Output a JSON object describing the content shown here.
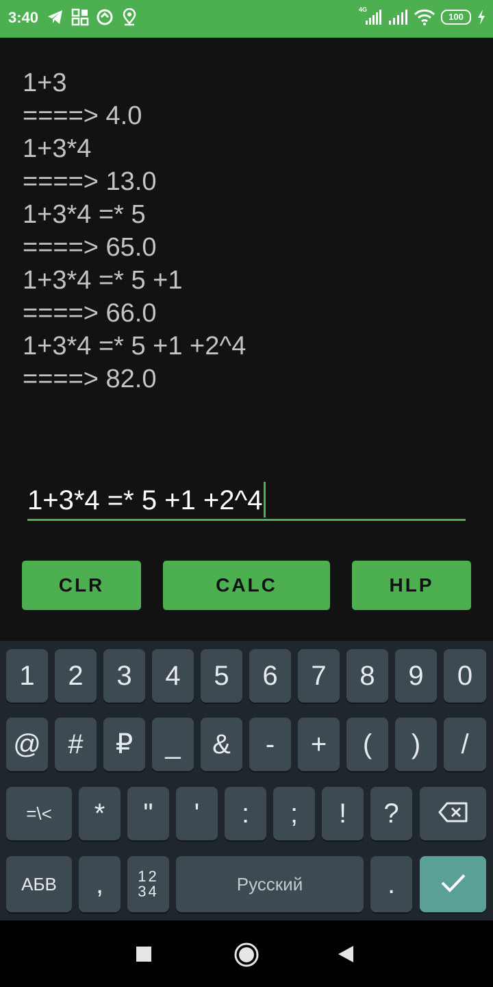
{
  "status_bar": {
    "time": "3:40",
    "network": "4G",
    "battery": "100",
    "icons": [
      "telegram-icon",
      "apps-icon",
      "sync-icon",
      "location-icon",
      "signal-icon",
      "wifi-icon",
      "battery-icon",
      "charging-icon"
    ]
  },
  "history": [
    "1+3",
    "====> 4.0",
    "1+3*4",
    "====> 13.0",
    "1+3*4 =* 5",
    "====> 65.0",
    "1+3*4 =* 5 +1",
    "====> 66.0",
    "1+3*4 =* 5 +1 +2^4",
    "====> 82.0"
  ],
  "input": {
    "value": "1+3*4 =* 5 +1 +2^4"
  },
  "buttons": {
    "clear": "CLR",
    "calc": "CALC",
    "help": "HLP"
  },
  "keyboard": {
    "row1": [
      "1",
      "2",
      "3",
      "4",
      "5",
      "6",
      "7",
      "8",
      "9",
      "0"
    ],
    "row2": [
      "@",
      "#",
      "₽",
      "_",
      "&",
      "-",
      "+",
      "(",
      ")",
      "/"
    ],
    "row3": [
      "=\\<",
      "*",
      "\"",
      "'",
      ":",
      ";",
      "!",
      "?"
    ],
    "row4": {
      "layout": "АБВ",
      "comma": ",",
      "numbers_top": "12",
      "numbers_bottom": "34",
      "space": "Русский",
      "period": "."
    }
  },
  "nav": {
    "icons": [
      "recents-icon",
      "home-icon",
      "back-icon"
    ]
  },
  "colors": {
    "accent": "#4caf50",
    "background": "#121212",
    "keyboard": "#1f272c",
    "key": "#3d4a52",
    "done_key": "#5aa097"
  }
}
